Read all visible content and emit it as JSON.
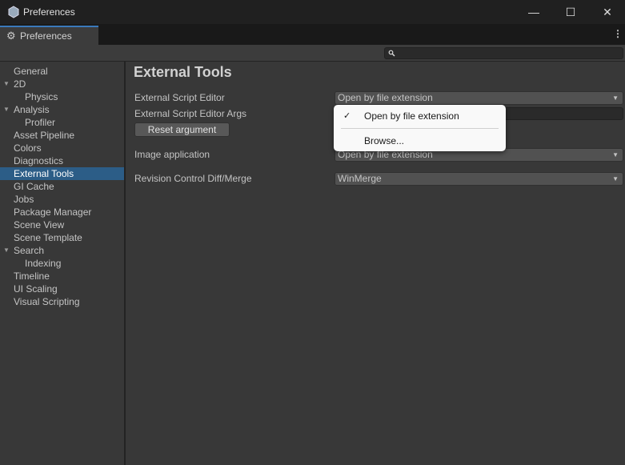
{
  "window": {
    "title": "Preferences",
    "minimize": "—",
    "maximize": "☐",
    "close": "✕"
  },
  "tab": {
    "label": "Preferences",
    "menu": "⋮"
  },
  "search": {
    "placeholder": ""
  },
  "sidebar": {
    "items": [
      {
        "label": "General",
        "indent": 0
      },
      {
        "label": "2D",
        "indent": 0,
        "expanded": true
      },
      {
        "label": "Physics",
        "indent": 1
      },
      {
        "label": "Analysis",
        "indent": 0,
        "expanded": true
      },
      {
        "label": "Profiler",
        "indent": 1
      },
      {
        "label": "Asset Pipeline",
        "indent": 0
      },
      {
        "label": "Colors",
        "indent": 0
      },
      {
        "label": "Diagnostics",
        "indent": 0
      },
      {
        "label": "External Tools",
        "indent": 0,
        "selected": true
      },
      {
        "label": "GI Cache",
        "indent": 0
      },
      {
        "label": "Jobs",
        "indent": 0
      },
      {
        "label": "Package Manager",
        "indent": 0
      },
      {
        "label": "Scene View",
        "indent": 0
      },
      {
        "label": "Scene Template",
        "indent": 0
      },
      {
        "label": "Search",
        "indent": 0,
        "expanded": true
      },
      {
        "label": "Indexing",
        "indent": 1
      },
      {
        "label": "Timeline",
        "indent": 0
      },
      {
        "label": "UI Scaling",
        "indent": 0
      },
      {
        "label": "Visual Scripting",
        "indent": 0
      }
    ]
  },
  "main": {
    "title": "External Tools",
    "script_editor_label": "External Script Editor",
    "script_editor_value": "Open by file extension",
    "args_label": "External Script Editor Args",
    "args_value": "",
    "reset_button": "Reset argument",
    "image_label": "Image application",
    "image_value": "Open by file extension",
    "revision_label": "Revision Control Diff/Merge",
    "revision_value": "WinMerge"
  },
  "popup": {
    "items": [
      {
        "label": "Open by file extension",
        "checked": true,
        "check": "✓"
      },
      {
        "label": "Browse..."
      }
    ]
  }
}
